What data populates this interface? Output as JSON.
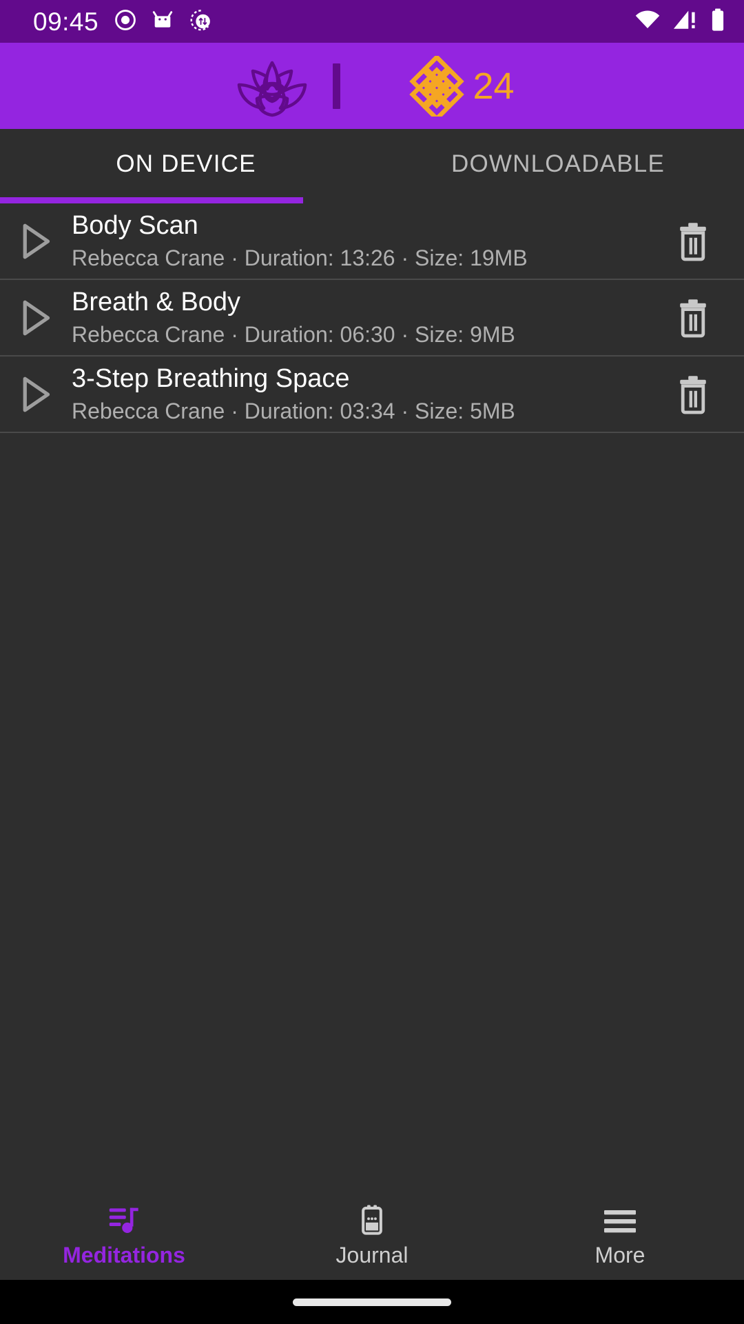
{
  "status_bar": {
    "time": "09:45",
    "left_icons": [
      "record-dot-icon",
      "android-robot-icon",
      "data-sync-icon"
    ],
    "right_icons": [
      "wifi-icon",
      "cellular-signal-warning-icon",
      "battery-icon"
    ],
    "background_color": "#620a8c"
  },
  "app_bar": {
    "lotus_icon": "lotus-icon",
    "divider": "vertical-divider",
    "streak_icon": "endless-knot-icon",
    "streak_count": "24",
    "background_color": "#9425e0",
    "accent_color": "#f5a623"
  },
  "tabs": {
    "items": [
      {
        "label": "ON DEVICE",
        "active": true
      },
      {
        "label": "DOWNLOADABLE",
        "active": false
      }
    ],
    "indicator_color": "#9425e0"
  },
  "meditations": [
    {
      "title": "Body Scan",
      "subtitle": "Rebecca Crane · Duration: 13:26 · Size: 19MB",
      "author": "Rebecca Crane",
      "duration": "13:26",
      "size": "19MB",
      "play_icon": "play-icon",
      "delete_icon": "trash-icon"
    },
    {
      "title": "Breath & Body",
      "subtitle": "Rebecca Crane · Duration: 06:30 · Size: 9MB",
      "author": "Rebecca Crane",
      "duration": "06:30",
      "size": "9MB",
      "play_icon": "play-icon",
      "delete_icon": "trash-icon"
    },
    {
      "title": "3-Step Breathing Space",
      "subtitle": "Rebecca Crane · Duration: 03:34 · Size: 5MB",
      "author": "Rebecca Crane",
      "duration": "03:34",
      "size": "5MB",
      "play_icon": "play-icon",
      "delete_icon": "trash-icon"
    }
  ],
  "bottom_nav": {
    "items": [
      {
        "label": "Meditations",
        "icon": "playlist-music-icon",
        "active": true
      },
      {
        "label": "Journal",
        "icon": "calendar-icon",
        "active": false
      },
      {
        "label": "More",
        "icon": "hamburger-menu-icon",
        "active": false
      }
    ],
    "active_color": "#9425e0",
    "inactive_color": "#cfcfcf"
  }
}
